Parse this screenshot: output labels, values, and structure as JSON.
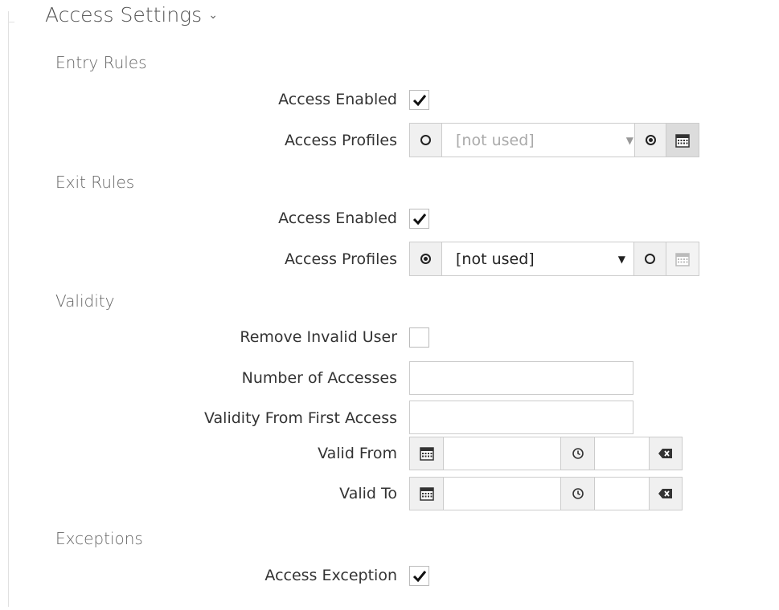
{
  "header": {
    "title": "Access Settings",
    "chevron": "⌄"
  },
  "entry_rules": {
    "section": "Entry Rules",
    "access_enabled": {
      "label": "Access Enabled",
      "checked": true
    },
    "access_profiles": {
      "label": "Access Profiles",
      "value": "[not used]",
      "select_mode": "calendar"
    }
  },
  "exit_rules": {
    "section": "Exit Rules",
    "access_enabled": {
      "label": "Access Enabled",
      "checked": true
    },
    "access_profiles": {
      "label": "Access Profiles",
      "value": "[not used]",
      "select_mode": "list"
    }
  },
  "validity": {
    "section": "Validity",
    "remove_invalid_user": {
      "label": "Remove Invalid User",
      "checked": false
    },
    "number_of_accesses": {
      "label": "Number of Accesses",
      "value": ""
    },
    "validity_from_first_access": {
      "label": "Validity From First Access",
      "value": ""
    },
    "valid_from": {
      "label": "Valid From",
      "date": "",
      "time": ""
    },
    "valid_to": {
      "label": "Valid To",
      "date": "",
      "time": ""
    }
  },
  "exceptions": {
    "section": "Exceptions",
    "access_exception": {
      "label": "Access Exception",
      "checked": true
    }
  },
  "icons": {
    "check": "check-icon",
    "calendar": "calendar-icon",
    "clock": "clock-icon",
    "clear": "backspace-clear-icon",
    "radio": "radio-icon",
    "caret": "caret-down-icon"
  }
}
